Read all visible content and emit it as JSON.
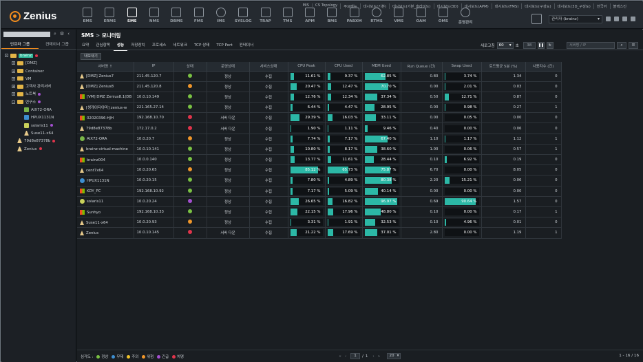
{
  "app": {
    "logo_text": "Zenius"
  },
  "nav": [
    {
      "label": "EMS",
      "icon": "monitor-icon"
    },
    {
      "label": "ERMS",
      "icon": "network-icon"
    },
    {
      "label": "SMS",
      "icon": "server-icon",
      "active": true
    },
    {
      "label": "NMS",
      "icon": "router-icon"
    },
    {
      "label": "DBMS",
      "icon": "database-icon"
    },
    {
      "label": "FMS",
      "icon": "facility-icon"
    },
    {
      "label": "IMS",
      "icon": "globe-icon"
    },
    {
      "label": "SYSLOG",
      "icon": "log-icon"
    },
    {
      "label": "TRAP",
      "icon": "trap-icon"
    },
    {
      "label": "TMS",
      "icon": "terminal-icon"
    },
    {
      "label": "APM",
      "icon": "app-icon"
    },
    {
      "label": "BMS",
      "icon": "download-icon"
    },
    {
      "label": "PABXM",
      "icon": "phone-icon"
    },
    {
      "label": "RTMS",
      "icon": "clock-icon"
    },
    {
      "label": "VMS",
      "icon": "cloud-icon"
    },
    {
      "label": "OAM",
      "icon": "monitor-icon"
    },
    {
      "label": "OMS",
      "icon": "display-icon"
    },
    {
      "label": "운영관리",
      "icon": "gear-icon"
    }
  ],
  "top_links": [
    "MIS",
    "CS Topology",
    "주요메뉴",
    "대시보드(기본)",
    "대시보드(기본_슬라이드)",
    "대시보드(3D)",
    "대시보드(APM)",
    "대시보드(FMS)",
    "대시보드(구성도)",
    "대시보드(3D_구성도)",
    "한국어",
    "블랙스킨"
  ],
  "user": {
    "label": "관리자 (brainz)"
  },
  "sidebar": {
    "search_placeholder": "",
    "tabs": [
      "인프라 그룹",
      "컨테이너 그룹"
    ],
    "tree": [
      {
        "label": "brainz",
        "level": 0,
        "type": "folder",
        "toggle": "-",
        "selected": true,
        "dot": "#e0344b"
      },
      {
        "label": "[DMZ]",
        "level": 1,
        "type": "folder",
        "toggle": "+"
      },
      {
        "label": "Container",
        "level": 1,
        "type": "folder",
        "toggle": "+"
      },
      {
        "label": "VM",
        "level": 1,
        "type": "folder",
        "toggle": "+"
      },
      {
        "label": "고객사 관리서버",
        "level": 1,
        "type": "folder",
        "toggle": "+"
      },
      {
        "label": "노트북",
        "level": 1,
        "type": "folder",
        "toggle": "+",
        "dot": "#a44fd1"
      },
      {
        "label": "연구소",
        "level": 1,
        "type": "folder",
        "toggle": "-",
        "dot": "#a44fd1"
      },
      {
        "label": "AIX72-ORA",
        "level": 2,
        "type": "aix"
      },
      {
        "label": "HPUX1131N",
        "level": 2,
        "type": "hp"
      },
      {
        "label": "solaris11",
        "level": 2,
        "type": "sun",
        "dot": "#a44fd1"
      },
      {
        "label": "Suse11-x64",
        "level": 2,
        "type": "linux"
      },
      {
        "label": "79d8e87378b",
        "level": 1,
        "type": "linux",
        "dot": "#e0344b"
      },
      {
        "label": "Zenius",
        "level": 1,
        "type": "linux",
        "dot": "#e0344b"
      }
    ]
  },
  "content": {
    "breadcrumb": [
      "SMS",
      ">",
      "모니터링"
    ],
    "tabs": [
      "요약",
      "관심항목",
      "성능",
      "저장장치",
      "프로세스",
      "네트워크",
      "TCP 상태",
      "TCP Port",
      "컨테이너"
    ],
    "refresh_label": "새로고침",
    "refresh_value": "60",
    "refresh_unit": "초",
    "refresh_count": "38",
    "search_placeholder": "서버명 / IP",
    "export_label": "내보내기",
    "columns": [
      "서버명 ↑",
      "IP",
      "상태",
      "운영상태",
      "서비스상태",
      "CPU Peak",
      "CPU Used",
      "MEM Used",
      "Run Queue (건)",
      "Swap Used",
      "로드평균 5분 (%)",
      "사용자수 (건)"
    ],
    "status_colors": {
      "green": "#7ac143",
      "red": "#e0344b",
      "orange": "#f0962a",
      "purple": "#a44fd1"
    },
    "rows": [
      {
        "name": "[DMZ] Zenius7",
        "os": "linux",
        "ip": "211.45.120.7",
        "status": "green",
        "op": "정상",
        "svc": "수집",
        "cpu_peak": "11.61 %",
        "cpu_peak_v": 11.61,
        "cpu_used": "9.37 %",
        "cpu_used_v": 9.37,
        "mem": "62.85 %",
        "mem_v": 62.85,
        "runq": "0.80",
        "swap": "3.74 %",
        "swap_v": 3.74,
        "load": "1.34",
        "users": "0"
      },
      {
        "name": "[DMZ] Zenius8",
        "os": "linux",
        "ip": "211.45.120.8",
        "status": "orange",
        "op": "정상",
        "svc": "수집",
        "cpu_peak": "20.47 %",
        "cpu_peak_v": 20.47,
        "cpu_used": "12.47 %",
        "cpu_used_v": 12.47,
        "mem": "70.70 %",
        "mem_v": 70.7,
        "runq": "0.00",
        "swap": "2.01 %",
        "swap_v": 2.01,
        "load": "0.03",
        "users": "0"
      },
      {
        "name": "[VM] DMZ Zenius8.1(DB",
        "os": "win",
        "ip": "10.0.10.149",
        "status": "green",
        "op": "정상",
        "svc": "수집",
        "cpu_peak": "12.76 %",
        "cpu_peak_v": 12.76,
        "cpu_used": "12.34 %",
        "cpu_used_v": 12.34,
        "mem": "37.34 %",
        "mem_v": 37.34,
        "runq": "0.50",
        "swap": "12.71 %",
        "swap_v": 12.71,
        "load": "0.87",
        "users": "0"
      },
      {
        "name": "[생개이터야미] zenius-w",
        "os": "linux",
        "ip": "221.165.27.14",
        "status": "green",
        "op": "정상",
        "svc": "수집",
        "cpu_peak": "6.44 %",
        "cpu_peak_v": 6.44,
        "cpu_used": "4.47 %",
        "cpu_used_v": 4.47,
        "mem": "28.95 %",
        "mem_v": 28.95,
        "runq": "0.00",
        "swap": "0.98 %",
        "swap_v": 0.98,
        "load": "0.27",
        "users": "1"
      },
      {
        "name": "02020396-HJH",
        "os": "win",
        "ip": "192.168.10.70",
        "status": "red",
        "op": "서버 다운",
        "svc": "수집",
        "cpu_peak": "29.39 %",
        "cpu_peak_v": 29.39,
        "cpu_used": "16.03 %",
        "cpu_used_v": 16.03,
        "mem": "33.11 %",
        "mem_v": 33.11,
        "runq": "0.00",
        "swap": "0.05 %",
        "swap_v": 0.05,
        "load": "0.00",
        "users": "0"
      },
      {
        "name": "79d8e87378b",
        "os": "linux",
        "ip": "172.17.0.2",
        "status": "red",
        "op": "서버 다운",
        "svc": "수집",
        "cpu_peak": "1.90 %",
        "cpu_peak_v": 1.9,
        "cpu_used": "1.11 %",
        "cpu_used_v": 1.11,
        "mem": "9.46 %",
        "mem_v": 9.46,
        "runq": "0.40",
        "swap": "0.00 %",
        "swap_v": 0,
        "load": "0.06",
        "users": "0"
      },
      {
        "name": "AIX72-ORA",
        "os": "aix",
        "ip": "10.0.20.7",
        "status": "orange",
        "op": "정상",
        "svc": "수집",
        "cpu_peak": "7.74 %",
        "cpu_peak_v": 7.74,
        "cpu_used": "7.17 %",
        "cpu_used_v": 7.17,
        "mem": "67.40 %",
        "mem_v": 67.4,
        "runq": "1.10",
        "swap": "1.17 %",
        "swap_v": 1.17,
        "load": "1.12",
        "users": "1"
      },
      {
        "name": "brainz-virtual-machine",
        "os": "linux",
        "ip": "10.0.10.141",
        "status": "green",
        "op": "정상",
        "svc": "수집",
        "cpu_peak": "10.80 %",
        "cpu_peak_v": 10.8,
        "cpu_used": "8.17 %",
        "cpu_used_v": 8.17,
        "mem": "38.60 %",
        "mem_v": 38.6,
        "runq": "1.00",
        "swap": "0.06 %",
        "swap_v": 0.06,
        "load": "0.57",
        "users": "1"
      },
      {
        "name": "brainz004",
        "os": "win",
        "ip": "10.0.0.140",
        "status": "green",
        "op": "정상",
        "svc": "수집",
        "cpu_peak": "13.77 %",
        "cpu_peak_v": 13.77,
        "cpu_used": "11.61 %",
        "cpu_used_v": 11.61,
        "mem": "28.44 %",
        "mem_v": 28.44,
        "runq": "0.10",
        "swap": "6.92 %",
        "swap_v": 6.92,
        "load": "0.19",
        "users": "0"
      },
      {
        "name": "cent7x64",
        "os": "linux",
        "ip": "10.0.20.65",
        "status": "orange",
        "op": "정상",
        "svc": "수집",
        "cpu_peak": "85.12 %",
        "cpu_peak_v": 85.12,
        "cpu_used": "65.73 %",
        "cpu_used_v": 65.73,
        "mem": "75.87 %",
        "mem_v": 75.87,
        "runq": "6.70",
        "swap": "0.00 %",
        "swap_v": 0,
        "load": "8.05",
        "users": "0"
      },
      {
        "name": "HPUX1131N",
        "os": "hp",
        "ip": "10.0.20.15",
        "status": "green",
        "op": "정상",
        "svc": "수집",
        "cpu_peak": "7.80 %",
        "cpu_peak_v": 7.8,
        "cpu_used": "4.89 %",
        "cpu_used_v": 4.89,
        "mem": "80.38 %",
        "mem_v": 80.38,
        "runq": "2.20",
        "swap": "15.21 %",
        "swap_v": 15.21,
        "load": "0.06",
        "users": "0"
      },
      {
        "name": "KDY_PC",
        "os": "win",
        "ip": "192.168.10.92",
        "status": "green",
        "op": "정상",
        "svc": "수집",
        "cpu_peak": "7.17 %",
        "cpu_peak_v": 7.17,
        "cpu_used": "5.09 %",
        "cpu_used_v": 5.09,
        "mem": "40.14 %",
        "mem_v": 40.14,
        "runq": "0.00",
        "swap": "0.00 %",
        "swap_v": 0,
        "load": "0.00",
        "users": "0"
      },
      {
        "name": "solaris11",
        "os": "sun",
        "ip": "10.0.20.24",
        "status": "purple",
        "op": "정상",
        "svc": "수집",
        "cpu_peak": "26.65 %",
        "cpu_peak_v": 26.65,
        "cpu_used": "16.82 %",
        "cpu_used_v": 16.82,
        "mem": "96.97 %",
        "mem_v": 96.97,
        "runq": "0.69",
        "swap": "90.64 %",
        "swap_v": 90.64,
        "load": "1.57",
        "users": "0"
      },
      {
        "name": "Sunhyo",
        "os": "win",
        "ip": "192.168.10.33",
        "status": "green",
        "op": "정상",
        "svc": "수집",
        "cpu_peak": "22.15 %",
        "cpu_peak_v": 22.15,
        "cpu_used": "17.96 %",
        "cpu_used_v": 17.96,
        "mem": "48.80 %",
        "mem_v": 48.8,
        "runq": "0.10",
        "swap": "0.00 %",
        "swap_v": 0,
        "load": "0.17",
        "users": "1"
      },
      {
        "name": "Suse11-x64",
        "os": "linux",
        "ip": "10.0.20.93",
        "status": "orange",
        "op": "정상",
        "svc": "수집",
        "cpu_peak": "3.31 %",
        "cpu_peak_v": 3.31,
        "cpu_used": "1.91 %",
        "cpu_used_v": 1.91,
        "mem": "32.53 %",
        "mem_v": 32.53,
        "runq": "0.10",
        "swap": "4.96 %",
        "swap_v": 4.96,
        "load": "0.01",
        "users": "0"
      },
      {
        "name": "Zenius",
        "os": "linux",
        "ip": "10.0.10.145",
        "status": "red",
        "op": "서버 다운",
        "svc": "수집",
        "cpu_peak": "21.22 %",
        "cpu_peak_v": 21.22,
        "cpu_used": "17.69 %",
        "cpu_used_v": 17.69,
        "mem": "37.01 %",
        "mem_v": 37.01,
        "runq": "2.80",
        "swap": "0.00 %",
        "swap_v": 0,
        "load": "1.19",
        "users": "1"
      }
    ],
    "legend_title": "심각도 :",
    "legend": [
      {
        "label": "정상",
        "color": "#7ac143"
      },
      {
        "label": "무제",
        "color": "#3e8fd1"
      },
      {
        "label": "주의",
        "color": "#f0c32a"
      },
      {
        "label": "위험",
        "color": "#f0962a"
      },
      {
        "label": "긴급",
        "color": "#a44fd1"
      },
      {
        "label": "치명",
        "color": "#e0344b"
      }
    ],
    "pager": {
      "current": "1",
      "sep": "/",
      "total": "1",
      "page_size": "20",
      "range": "1 - 16 / 16"
    }
  }
}
